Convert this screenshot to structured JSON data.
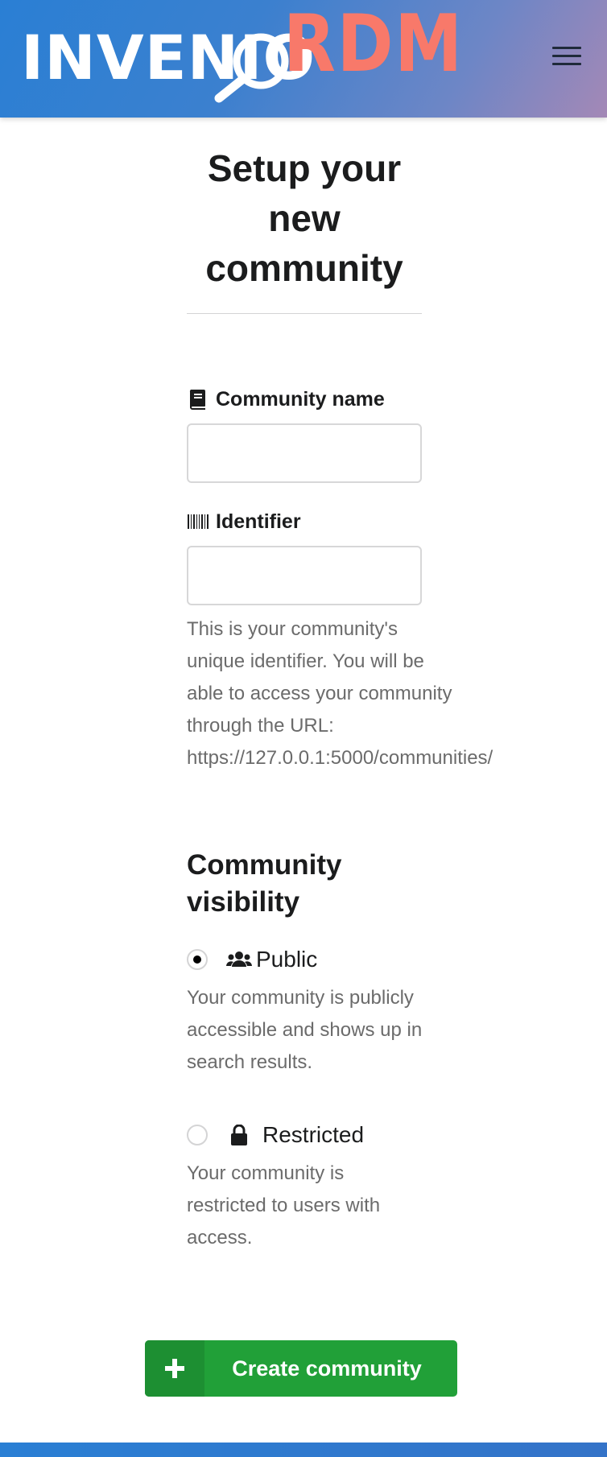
{
  "header": {
    "logo_text_primary": "INVENIO",
    "logo_text_secondary": "RDM",
    "menu_icon": "hamburger-menu-icon",
    "colors": {
      "gradient_start": "#2a7fd4",
      "gradient_end": "#a488b6",
      "rdm_accent": "#f8796a"
    }
  },
  "page": {
    "title": "Setup your new community"
  },
  "form": {
    "name_field": {
      "label": "Community name",
      "icon": "book-icon",
      "value": "",
      "placeholder": ""
    },
    "identifier_field": {
      "label": "Identifier",
      "icon": "barcode-icon",
      "value": "",
      "placeholder": "",
      "help": "This is your community's unique identifier. You will be able to access your community through the URL: https://127.0.0.1:5000/communities/"
    },
    "visibility": {
      "title": "Community visibility",
      "options": [
        {
          "label": "Public",
          "icon": "users-icon",
          "selected": true,
          "description": "Your community is publicly accessible and shows up in search results."
        },
        {
          "label": "Restricted",
          "icon": "lock-icon",
          "selected": false,
          "description": "Your community is restricted to users with access."
        }
      ]
    },
    "submit": {
      "label": "Create community",
      "icon": "plus-icon",
      "color": "#21a038"
    }
  }
}
